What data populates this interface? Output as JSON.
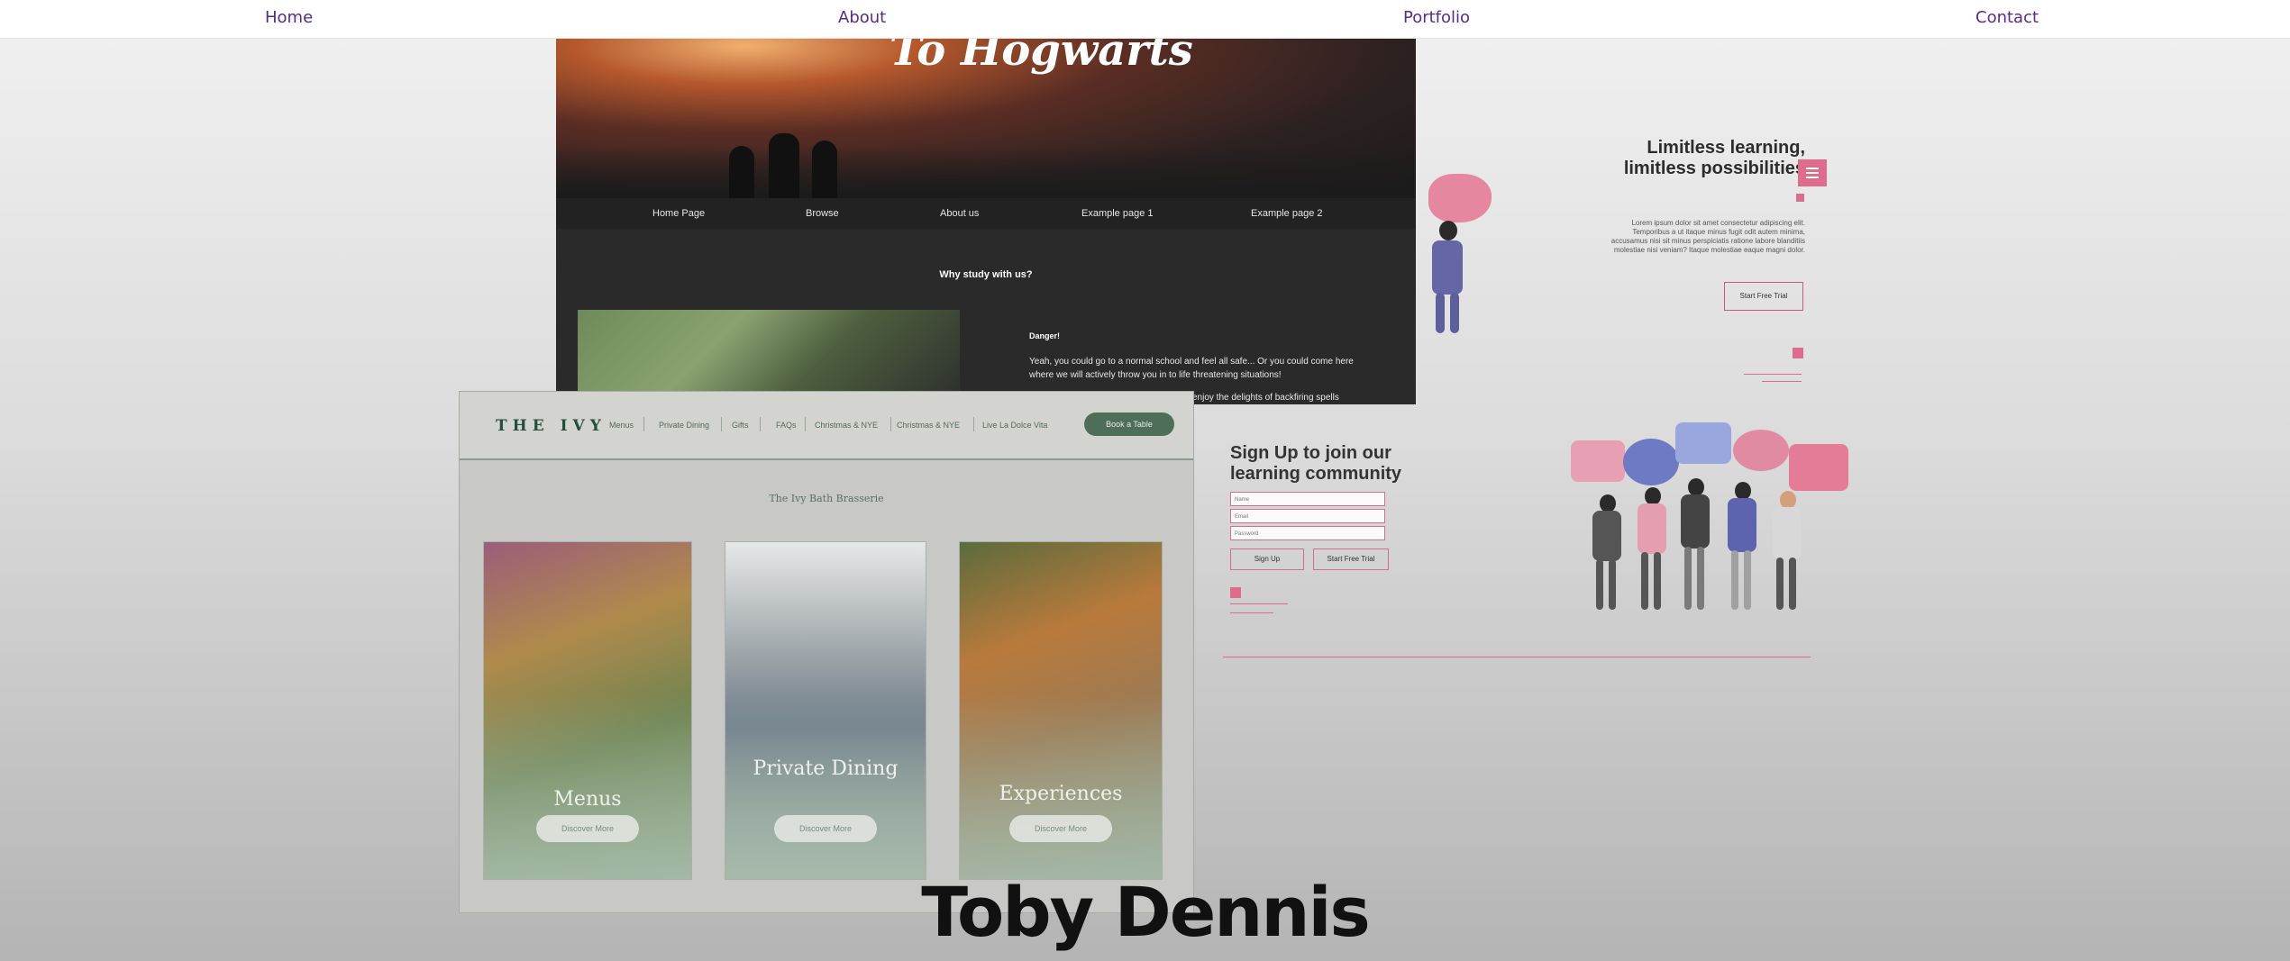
{
  "nav": {
    "items": [
      "Home",
      "About",
      "Portfolio",
      "Contact"
    ]
  },
  "hogwarts": {
    "title": "To Hogwarts",
    "nav": [
      "Home Page",
      "Browse",
      "About us",
      "Example page 1",
      "Example page 2"
    ],
    "section_title": "Why study with us?",
    "danger": "Danger!",
    "text": "Yeah, you could go to a normal school and feel all safe... Or you could come here where we will actively throw you in to life threatening situations!",
    "text2": "enjoy the delights of backfiring spells"
  },
  "learning": {
    "heading_line1": "Limitless learning,",
    "heading_line2": "limitless possibilities",
    "paragraph": "Lorem ipsum dolor sit amet consectetur adipiscing elit. Temporibus a ut itaque minus fugit odit autem minima, accusamus nisi sit minus perspiciatis ratione labore blanditiis molestiae nisi veniam? Itaque molestiae eaque magni dolor.",
    "cta": "Start Free Trial",
    "signup_heading_line1": "Sign Up to join our",
    "signup_heading_line2": "learning community",
    "fields": [
      "Name",
      "Email",
      "Password"
    ],
    "signup_button": "Sign Up",
    "trial_button": "Start Free Trial",
    "accent_color": "#e06c8d"
  },
  "ivy": {
    "logo": "THE IVY",
    "nav": [
      "Menus",
      "Private Dining",
      "Gifts",
      "FAQs",
      "Christmas & NYE",
      "Christmas & NYE",
      "Live La Dolce Vita"
    ],
    "book": "Book a Table",
    "subtitle": "The Ivy Bath Brasserie",
    "cards": [
      {
        "label": "Menus",
        "button": "Discover More"
      },
      {
        "label": "Private Dining",
        "button": "Discover More"
      },
      {
        "label": "Experiences",
        "button": "Discover More"
      }
    ],
    "brand_color": "#4f6e59"
  },
  "owner_name": "Toby Dennis"
}
